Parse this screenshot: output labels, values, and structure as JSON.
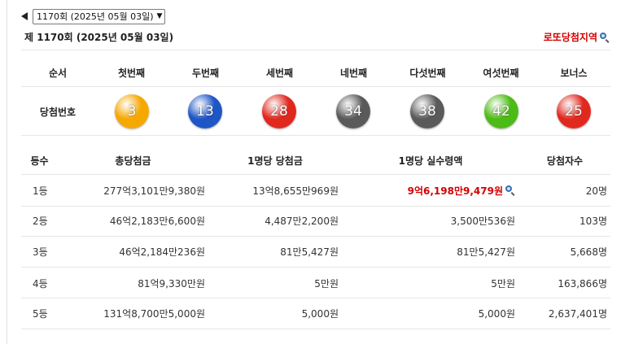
{
  "nav": {
    "prev_icon": "left-triangle-icon",
    "round_select_value": "1170회 (2025년 05월 03일)"
  },
  "header": {
    "title": "제 1170회 (2025년 05월 03일)",
    "region_link": "로또당첨지역",
    "region_icon": "magnifier-icon"
  },
  "numbers_table": {
    "headers": [
      "순서",
      "첫번째",
      "두번째",
      "세번째",
      "네번째",
      "다섯번째",
      "여섯번째",
      "보너스"
    ],
    "row_label": "당첨번호",
    "balls": [
      {
        "num": "3",
        "color": "#f5a800"
      },
      {
        "num": "13",
        "color": "#1f56c6"
      },
      {
        "num": "28",
        "color": "#e1281f"
      },
      {
        "num": "34",
        "color": "#5a5a5a"
      },
      {
        "num": "38",
        "color": "#5a5a5a"
      },
      {
        "num": "42",
        "color": "#4dbb16"
      },
      {
        "num": "25",
        "color": "#e1281f"
      }
    ]
  },
  "prize_table": {
    "headers": [
      "등수",
      "총당첨금",
      "1명당 당첨금",
      "1명당 실수령액",
      "당첨자수"
    ],
    "rows": [
      {
        "rank": "1등",
        "total": "277억3,101만9,380원",
        "per_winner": "13억8,655만969원",
        "actual": "9억6,198만9,479원",
        "winners": "20명"
      },
      {
        "rank": "2등",
        "total": "46억2,183만6,600원",
        "per_winner": "4,487만2,200원",
        "actual": "3,500만536원",
        "winners": "103명"
      },
      {
        "rank": "3등",
        "total": "46억2,184만236원",
        "per_winner": "81만5,427원",
        "actual": "81만5,427원",
        "winners": "5,668명"
      },
      {
        "rank": "4등",
        "total": "81억9,330만원",
        "per_winner": "5만원",
        "actual": "5만원",
        "winners": "163,866명"
      },
      {
        "rank": "5등",
        "total": "131억8,700만5,000원",
        "per_winner": "5,000원",
        "actual": "5,000원",
        "winners": "2,637,401명"
      }
    ]
  },
  "colors": {
    "accent_red": "#d20000",
    "link_blue": "#3b6fb5"
  }
}
